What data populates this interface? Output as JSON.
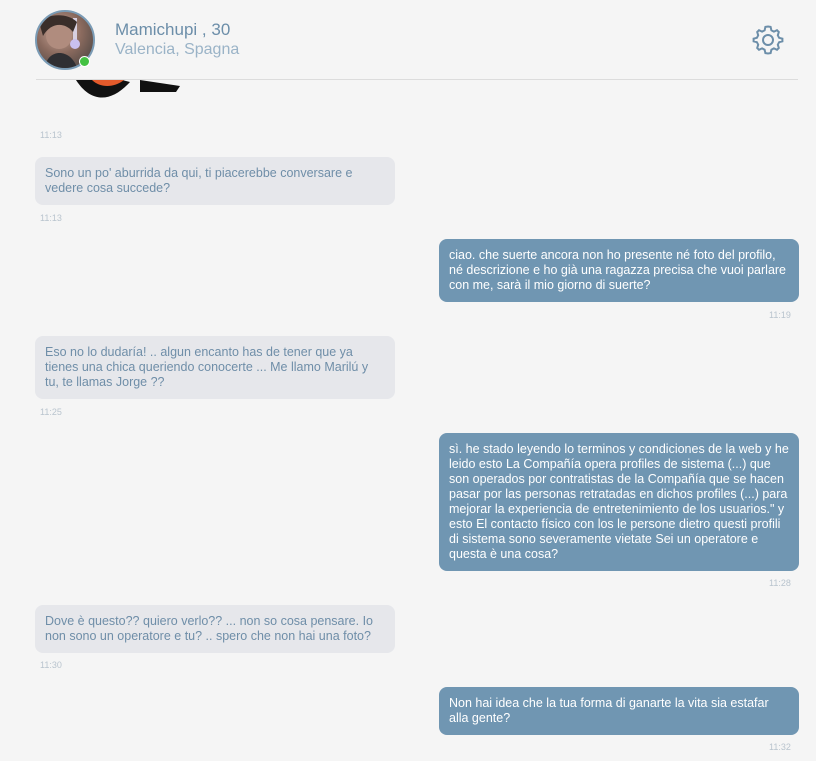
{
  "profile": {
    "name_age": "Mamichupi , 30",
    "location": "Valencia, Spagna",
    "status_color": "#43c142"
  },
  "header": {
    "settings_icon": "gear-icon"
  },
  "messages": [
    {
      "direction": "in",
      "text": "",
      "time": "11:13"
    },
    {
      "direction": "in",
      "text": "Sono un po' aburrida da qui, ti piacerebbe conversare e vedere cosa succede?",
      "time": "11:13"
    },
    {
      "direction": "out",
      "text": "ciao. che suerte ancora non ho presente né foto del profilo, né descrizione e ho già una ragazza precisa che vuoi parlare con me, sarà il mio giorno di suerte?",
      "time": "11:19"
    },
    {
      "direction": "in",
      "text": "Eso no lo dudaría! .. algun encanto has de tener que ya tienes una chica queriendo conocerte ... Me llamo Marilú y tu, te llamas Jorge ??",
      "time": "11:25"
    },
    {
      "direction": "out",
      "text": "sì. he stado leyendo lo terminos y condiciones de la web y he leido esto La Compañía opera profiles de sistema (...) que son operados por contratistas de la Compañía que se hacen pasar por las personas retratadas en dichos profiles (...) para mejorar la experiencia de entretenimiento de los usuarios.\" y esto El contacto físico con los le persone dietro questi profili di sistema sono severamente vietate Sei un operatore e questa è una cosa?",
      "time": "11:28"
    },
    {
      "direction": "in",
      "text": "Dove è questo?? quiero verlo?? ... non so cosa pensare. Io non sono un operatore e tu? .. spero che non hai una foto?",
      "time": "11:30"
    },
    {
      "direction": "out",
      "text": "Non hai idea che la tua forma di ganarte la vita sia estafar alla gente?",
      "time": "11:32"
    }
  ],
  "colors": {
    "incoming_bubble": "#e6e7eb",
    "incoming_text": "#6f8ea8",
    "outgoing_bubble": "#7096b2",
    "outgoing_text": "#ffffff",
    "accent": "#6c8ea9"
  }
}
